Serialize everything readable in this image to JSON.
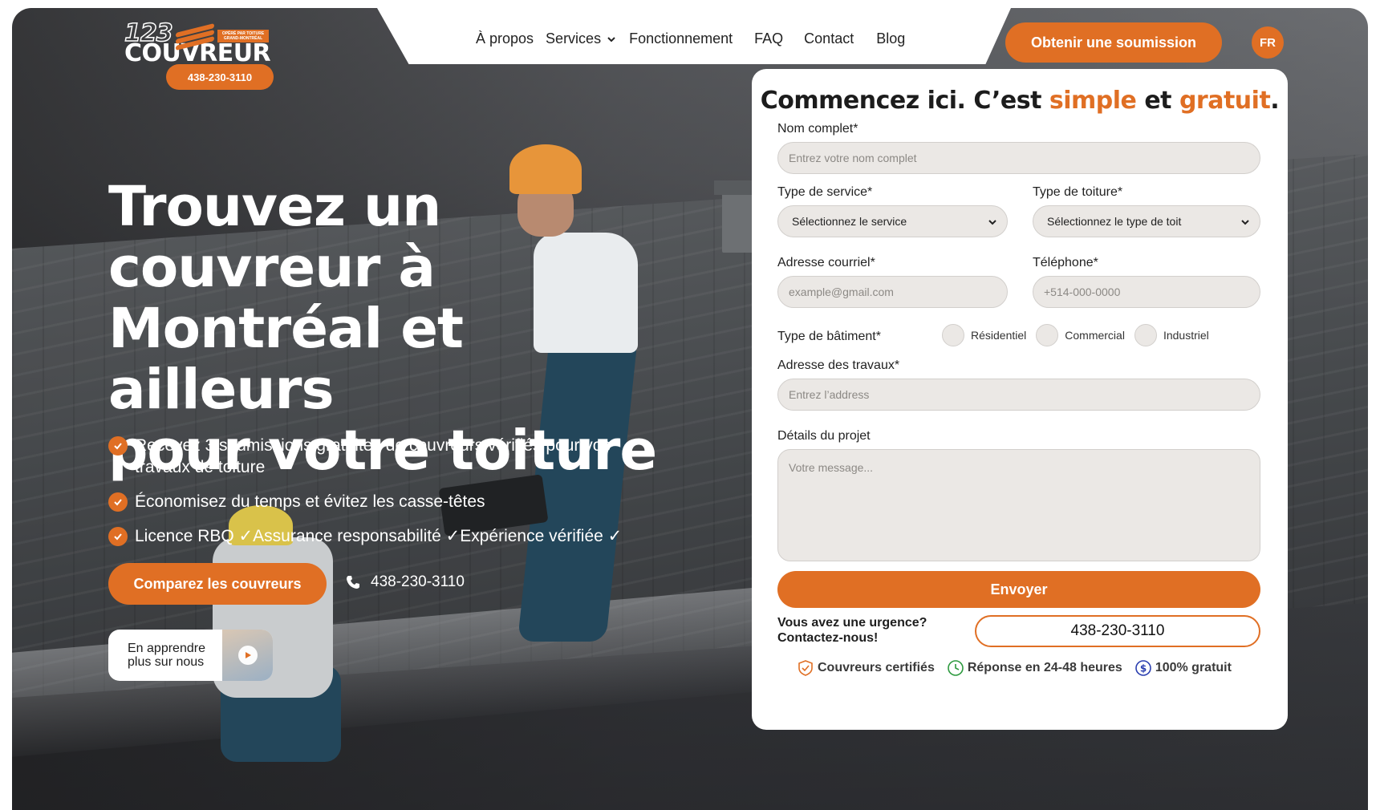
{
  "brand": {
    "logo_number": "123",
    "logo_tagline": "OPÉRÉ PAR TOITURE GRAND-MONTRÉAL",
    "logo_word": "COUVREUR",
    "logo_phone": "438-230-3110",
    "accent_color": "#e06f24"
  },
  "nav": {
    "items": [
      {
        "label": "À propos"
      },
      {
        "label": "Services"
      },
      {
        "label": "Fonctionnement"
      },
      {
        "label": "FAQ"
      },
      {
        "label": "Contact"
      },
      {
        "label": "Blog"
      }
    ],
    "cta_label": "Obtenir une soumission",
    "lang_label": "FR"
  },
  "hero": {
    "title_lines": [
      "Trouvez un",
      "couvreur à",
      "Montréal et ailleurs",
      "pour votre toiture"
    ],
    "bullets": [
      "Recevez 3 soumissions gratuites de couvreurs vérifiés pour vos travaux de toiture",
      "Économisez du temps et évitez les casse-têtes",
      "Licence RBQ ✓Assurance responsabilité ✓Expérience vérifiée ✓"
    ],
    "compare_button": "Comparez les couvreurs",
    "phone": "438-230-3110",
    "learn_more_line1": "En apprendre",
    "learn_more_line2": "plus sur nous"
  },
  "form": {
    "title_part1": "Commencez ici. C’est ",
    "title_word1": "simple",
    "title_part2": " et ",
    "title_word2": "gratuit",
    "title_end": ".",
    "full_name_label": "Nom complet*",
    "full_name_placeholder": "Entrez votre nom complet",
    "service_type_label": "Type de service*",
    "service_type_value": "Sélectionnez le service",
    "roof_type_label": "Type de toiture*",
    "roof_type_value": "Sélectionnez le type de toit",
    "email_label": "Adresse courriel*",
    "email_placeholder": "example@gmail.com",
    "phone_label": "Téléphone*",
    "phone_placeholder": "+514-000-0000",
    "building_type_label": "Type de bâtiment*",
    "building_options": [
      "Résidentiel",
      "Commercial",
      "Industriel"
    ],
    "address_label": "Adresse des travaux*",
    "address_placeholder": "Entrez l’address",
    "details_label": "Détails du projet",
    "details_placeholder": "Votre message...",
    "submit_label": "Envoyer",
    "urgent_line1": "Vous avez une urgence?",
    "urgent_line2": "Contactez-nous!",
    "urgent_phone": "438-230-3110",
    "badges": [
      "Couvreurs certifiés",
      "Réponse en 24-48 heures",
      "100% gratuit"
    ],
    "badge_icons": [
      "shield-check-icon",
      "clock-icon",
      "dollar-circle-icon"
    ],
    "badge_colors": [
      "#e06f24",
      "#2e9a3f",
      "#2b3fb0"
    ]
  }
}
